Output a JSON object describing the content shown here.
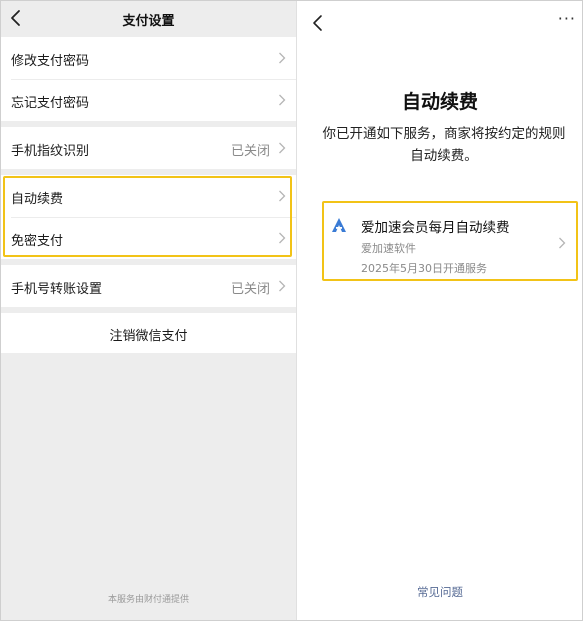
{
  "left": {
    "title": "支付设置",
    "groups": [
      [
        {
          "label": "修改支付密码",
          "value": ""
        },
        {
          "label": "忘记支付密码",
          "value": ""
        }
      ],
      [
        {
          "label": "手机指纹识别",
          "value": "已关闭"
        }
      ],
      [
        {
          "label": "自动续费",
          "value": ""
        },
        {
          "label": "免密支付",
          "value": ""
        }
      ],
      [
        {
          "label": "手机号转账设置",
          "value": "已关闭"
        }
      ]
    ],
    "cancel_label": "注销微信支付",
    "footer": "本服务由财付通提供"
  },
  "right": {
    "more": "···",
    "title": "自动续费",
    "description": "你已开通如下服务，商家将按约定的规则自动续费。",
    "service": {
      "name": "爱加速会员每月自动续费",
      "vendor": "爱加速软件",
      "date": "2025年5月30日开通服务",
      "icon": "a-logo-icon"
    },
    "faq": "常见问题"
  },
  "colors": {
    "highlight": "#f2c317",
    "link": "#576b95",
    "muted": "#8a8a8a",
    "panel_bg": "#ededed",
    "icon_blue": "#3a7bd5"
  }
}
